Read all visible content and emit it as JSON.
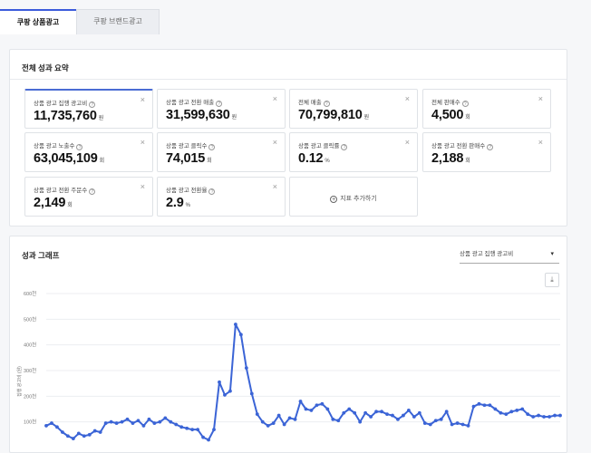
{
  "tabs": [
    {
      "label": "쿠팡 상품광고",
      "active": true
    },
    {
      "label": "쿠팡 브랜드광고",
      "active": false
    }
  ],
  "summary": {
    "title": "전체 성과 요약",
    "cards": [
      {
        "label": "상품 광고 집행 광고비",
        "value": "11,735,760",
        "unit": "원"
      },
      {
        "label": "상품 광고 전환 매출",
        "value": "31,599,630",
        "unit": "원"
      },
      {
        "label": "전체 매출",
        "value": "70,799,810",
        "unit": "원"
      },
      {
        "label": "전체 판매수",
        "value": "4,500",
        "unit": "회"
      },
      {
        "label": "상품 광고 노출수",
        "value": "63,045,109",
        "unit": "회"
      },
      {
        "label": "상품 광고 클릭수",
        "value": "74,015",
        "unit": "회"
      },
      {
        "label": "상품 광고 클릭률",
        "value": "0.12",
        "unit": "%"
      },
      {
        "label": "상품 광고 전환 판매수",
        "value": "2,188",
        "unit": "회"
      },
      {
        "label": "상품 광고 전환 주문수",
        "value": "2,149",
        "unit": "회"
      },
      {
        "label": "상품 광고 전환율",
        "value": "2.9",
        "unit": "%"
      }
    ],
    "add_label": "지표 추가하기",
    "close_glyph": "×",
    "help_glyph": "?"
  },
  "graph": {
    "title": "성과 그래프",
    "dropdown_value": "상품 광고 집행 광고비",
    "caret": "▾",
    "download_glyph": "⤓"
  },
  "colors": {
    "accent": "#3b5bdb",
    "line": "#3b64d6"
  },
  "chart_data": {
    "type": "line",
    "ylabel": "집행 광고비 (원)",
    "ylim": [
      0,
      600
    ],
    "yticks": [
      100,
      200,
      300,
      400,
      500,
      600
    ],
    "ytick_labels": [
      "100천",
      "200천",
      "300천",
      "400천",
      "500천",
      "600천"
    ],
    "series": [
      {
        "values": [
          85,
          95,
          80,
          60,
          45,
          35,
          55,
          45,
          50,
          65,
          60,
          95,
          100,
          95,
          100,
          110,
          95,
          105,
          85,
          110,
          95,
          100,
          115,
          100,
          90,
          80,
          75,
          70,
          70,
          40,
          30,
          70,
          255,
          205,
          220,
          480,
          440,
          310,
          210,
          130,
          100,
          85,
          95,
          125,
          90,
          115,
          110,
          180,
          150,
          145,
          165,
          170,
          150,
          110,
          105,
          135,
          150,
          135,
          100,
          135,
          120,
          140,
          140,
          130,
          125,
          110,
          125,
          145,
          120,
          135,
          95,
          90,
          105,
          110,
          140,
          90,
          95,
          90,
          85,
          160,
          170,
          165,
          165,
          150,
          135,
          130,
          140,
          145,
          150,
          130,
          120,
          125,
          120,
          120,
          125,
          125
        ]
      }
    ]
  }
}
